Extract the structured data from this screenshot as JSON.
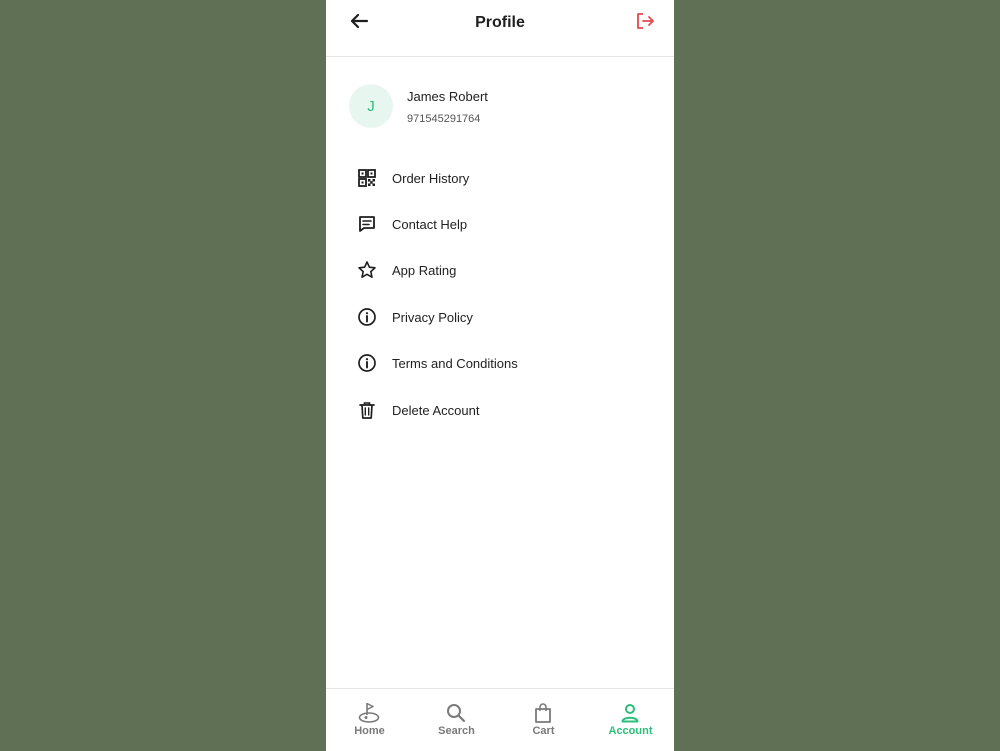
{
  "header": {
    "title": "Profile",
    "back_icon": "arrow-left-icon",
    "logout_icon": "logout-icon",
    "logout_color": "#e5484d"
  },
  "profile": {
    "initial": "J",
    "name": "James Robert",
    "phone": "971545291764",
    "avatar_bg": "#e7f7ef",
    "avatar_color": "#2bbf7a"
  },
  "menu": {
    "items": [
      {
        "label": "Order History",
        "icon": "qr-code-icon"
      },
      {
        "label": "Contact Help",
        "icon": "chat-icon"
      },
      {
        "label": "App Rating",
        "icon": "star-icon"
      },
      {
        "label": "Privacy Policy",
        "icon": "info-icon"
      },
      {
        "label": "Terms and Conditions",
        "icon": "info-icon"
      },
      {
        "label": "Delete Account",
        "icon": "trash-icon"
      }
    ]
  },
  "nav": {
    "items": [
      {
        "label": "Home",
        "icon": "golf-icon",
        "active": false
      },
      {
        "label": "Search",
        "icon": "search-icon",
        "active": false
      },
      {
        "label": "Cart",
        "icon": "bag-icon",
        "active": false
      },
      {
        "label": "Account",
        "icon": "user-icon",
        "active": true
      }
    ],
    "active_color": "#2bbf7a",
    "inactive_color": "#7a7a7a"
  }
}
